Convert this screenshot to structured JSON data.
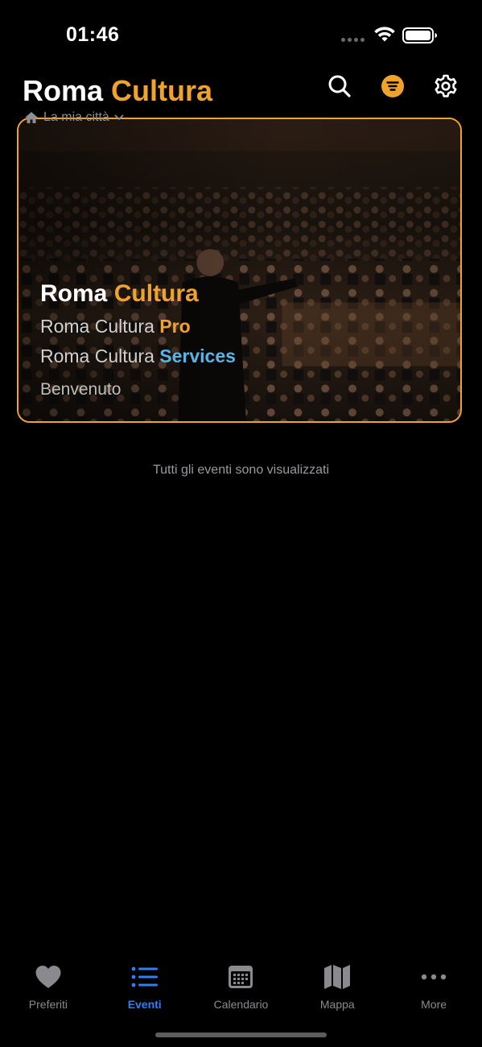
{
  "status_bar": {
    "time": "01:46",
    "icons": [
      "cellular-signal-icon",
      "wifi-icon",
      "battery-icon"
    ]
  },
  "header": {
    "title_part1": "Roma",
    "title_part2": "Cultura",
    "city_label": "La mia città",
    "actions": [
      "search-icon",
      "filter-icon",
      "settings-gear-icon"
    ]
  },
  "hero": {
    "line1_part1": "Roma",
    "line1_part2": "Cultura",
    "line2_part1": "Roma Cultura",
    "line2_part2": "Pro",
    "line3_part1": "Roma Cultura",
    "line3_part2": "Services",
    "welcome": "Benvenuto"
  },
  "main": {
    "empty_message": "Tutti gli eventi sono visualizzati"
  },
  "tab_bar": {
    "items": [
      {
        "label": "Preferiti",
        "icon": "heart-icon",
        "active": false
      },
      {
        "label": "Eventi",
        "icon": "list-icon",
        "active": true
      },
      {
        "label": "Calendario",
        "icon": "calendar-icon",
        "active": false
      },
      {
        "label": "Mappa",
        "icon": "map-icon",
        "active": false
      },
      {
        "label": "More",
        "icon": "more-icon",
        "active": false
      }
    ]
  },
  "colors": {
    "accent_orange": "#f0a32c",
    "accent_blue": "#5ab4e6",
    "active_tab": "#2f7ef6",
    "inactive": "#8a8a8e",
    "background": "#000000"
  }
}
